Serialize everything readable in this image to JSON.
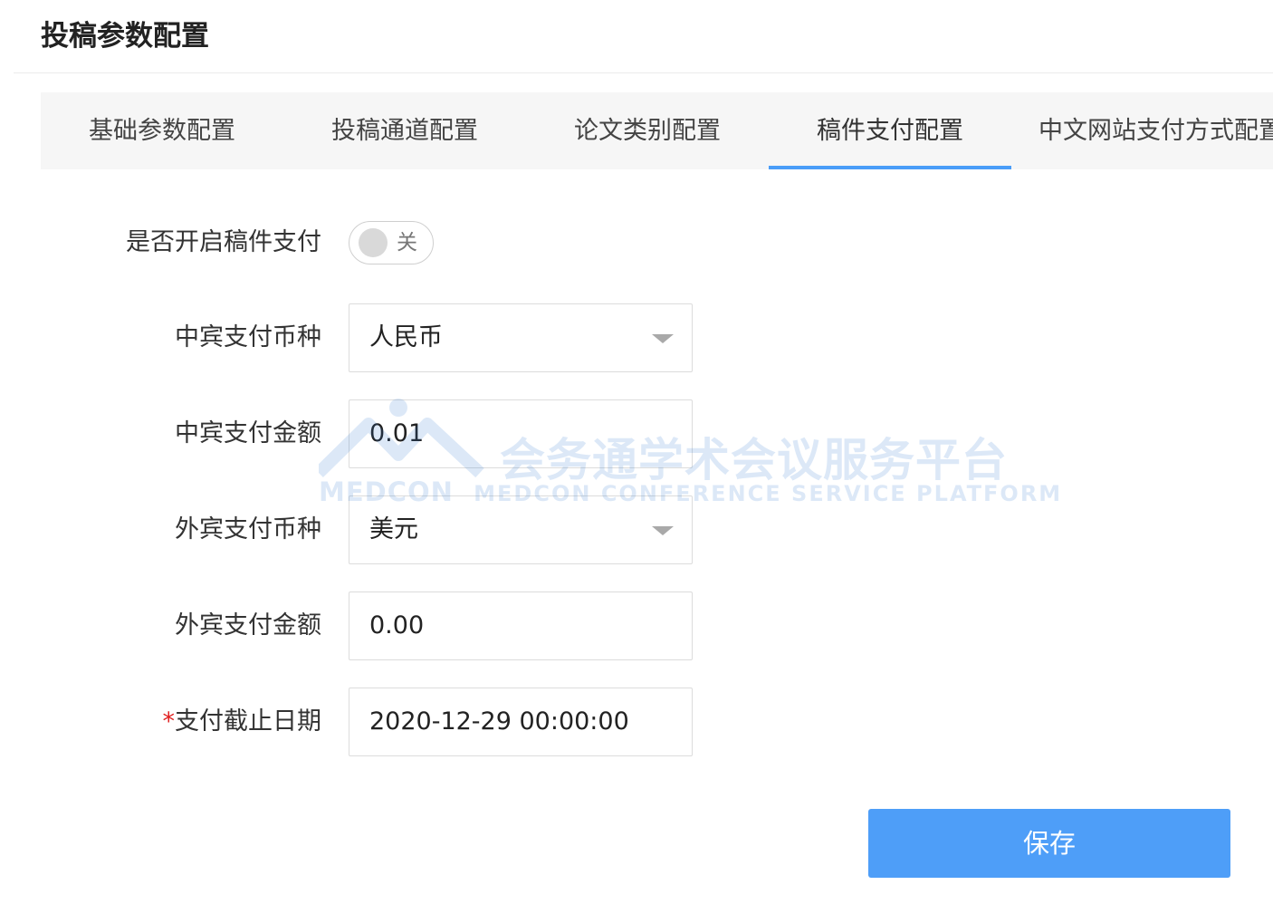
{
  "page_title": "投稿参数配置",
  "tabs": [
    {
      "label": "基础参数配置",
      "active": false
    },
    {
      "label": "投稿通道配置",
      "active": false
    },
    {
      "label": "论文类别配置",
      "active": false
    },
    {
      "label": "稿件支付配置",
      "active": true
    },
    {
      "label": "中文网站支付方式配置",
      "active": false
    }
  ],
  "form": {
    "payment_toggle": {
      "label": "是否开启稿件支付",
      "state_text": "关",
      "enabled": false
    },
    "domestic_currency": {
      "label": "中宾支付币种",
      "value": "人民币"
    },
    "domestic_amount": {
      "label": "中宾支付金额",
      "value": "0.01"
    },
    "foreign_currency": {
      "label": "外宾支付币种",
      "value": "美元"
    },
    "foreign_amount": {
      "label": "外宾支付金额",
      "value": "0.00"
    },
    "deadline": {
      "required_mark": "*",
      "label": "支付截止日期",
      "value": "2020-12-29 00:00:00"
    }
  },
  "save_label": "保存",
  "watermark": {
    "chinese": "会务通学术会议服务平台",
    "logo_text": "MEDCON",
    "english": "MEDCON CONFERENCE SERVICE PLATFORM"
  },
  "colors": {
    "accent": "#4e9ef8",
    "tab_indicator": "#4a9df8",
    "required": "#e02020",
    "tabs_background": "#f6f6f6"
  }
}
